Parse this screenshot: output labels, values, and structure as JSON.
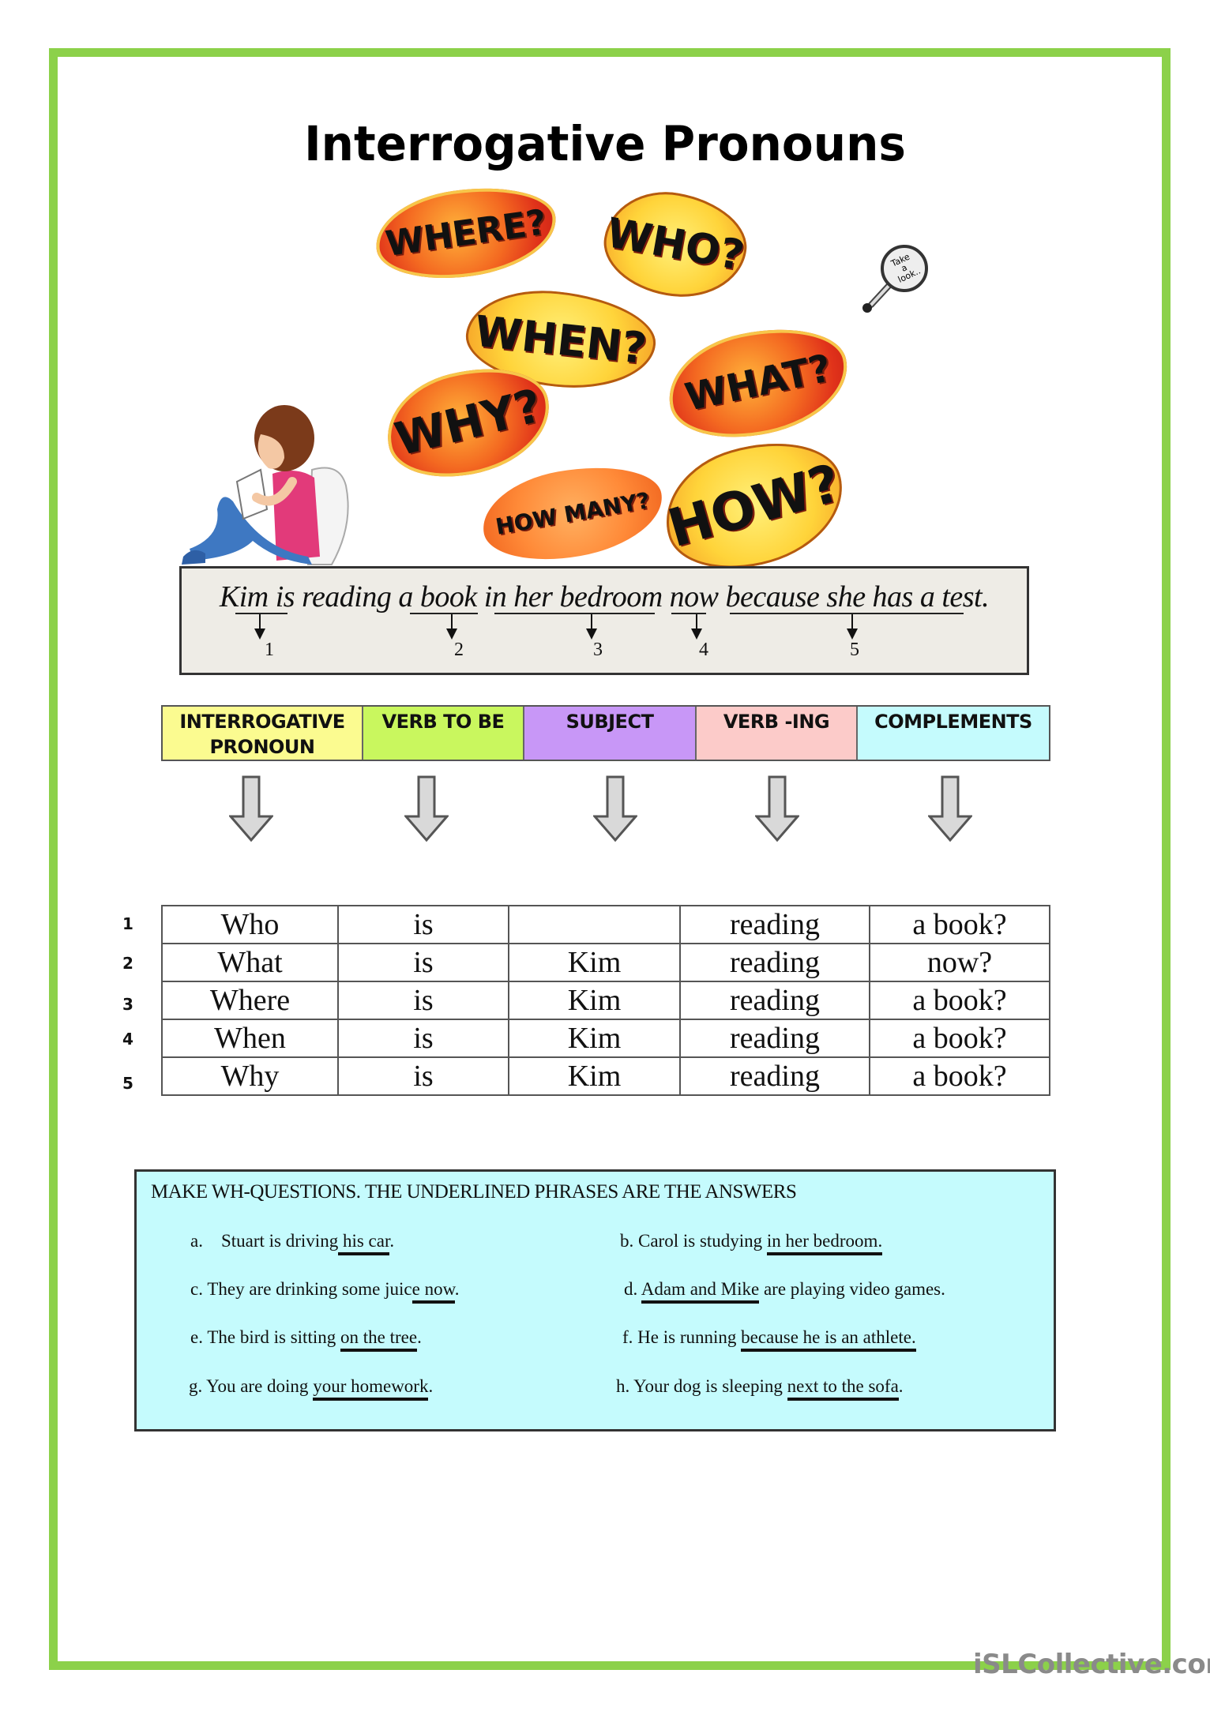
{
  "page": {
    "title": "Interrogative Pronouns",
    "border_color": "#8cd14a",
    "watermark": "iSLCollective.com"
  },
  "illustration": {
    "bubbles": [
      {
        "text": "WHERE?",
        "style": "red"
      },
      {
        "text": "WHO?",
        "style": "yellow"
      },
      {
        "text": "WHEN?",
        "style": "yellow"
      },
      {
        "text": "WHAT?",
        "style": "red"
      },
      {
        "text": "WHY?",
        "style": "red"
      },
      {
        "text": "HOW MANY?",
        "style": "orange"
      },
      {
        "text": "HOW?",
        "style": "yellow"
      }
    ],
    "magnifier_text": "Take a look..",
    "girl_alt": "girl reading a book"
  },
  "sentence_box": {
    "parts": [
      {
        "text": "Kim",
        "underlined": true,
        "number": "1"
      },
      {
        "text": " is reading ",
        "underlined": false
      },
      {
        "text": "a book",
        "underlined": true,
        "number": "2"
      },
      {
        "text": " ",
        "underlined": false
      },
      {
        "text": "in her bedroom",
        "underlined": true,
        "number": "3"
      },
      {
        "text": " ",
        "underlined": false
      },
      {
        "text": "now",
        "underlined": true,
        "number": "4"
      },
      {
        "text": " ",
        "underlined": false
      },
      {
        "text": "because she has a test.",
        "underlined": true,
        "number": "5"
      }
    ],
    "numbers": [
      "1",
      "2",
      "3",
      "4",
      "5"
    ]
  },
  "structure_header": [
    {
      "label_line1": "INTERROGATIVE",
      "label_line2": "PRONOUN",
      "color": "#fbfb90"
    },
    {
      "label_line1": "VERB TO BE",
      "label_line2": "",
      "color": "#c9f75e"
    },
    {
      "label_line1": "SUBJECT",
      "label_line2": "",
      "color": "#c897f7"
    },
    {
      "label_line1": "VERB -ING",
      "label_line2": "",
      "color": "#fccbc9"
    },
    {
      "label_line1": "COMPLEMENTS",
      "label_line2": "",
      "color": "#c5fbfd"
    }
  ],
  "questions_table": {
    "rows": [
      {
        "num": "1",
        "cells": [
          "Who",
          "is",
          "",
          "reading",
          "a book?"
        ]
      },
      {
        "num": "2",
        "cells": [
          "What",
          "is",
          "Kim",
          "reading",
          "now?"
        ]
      },
      {
        "num": "3",
        "cells": [
          "Where",
          "is",
          "Kim",
          "reading",
          "a book?"
        ]
      },
      {
        "num": "4",
        "cells": [
          "When",
          "is",
          "Kim",
          "reading",
          "a book?"
        ]
      },
      {
        "num": "5",
        "cells": [
          "Why",
          "is",
          "Kim",
          "reading",
          "a book?"
        ]
      }
    ]
  },
  "exercise": {
    "title": "MAKE WH-QUESTIONS. THE UNDERLINED PHRASES ARE THE ANSWERS",
    "background": "#c5fbfd",
    "items": [
      {
        "label": "a.",
        "before": "Stuart is driving",
        "underlined": " his car",
        "after": "."
      },
      {
        "label": "b.",
        "before": "Carol is studying ",
        "underlined": "in her bedroom.",
        "after": ""
      },
      {
        "label": "c.",
        "before": "They are drinking some juic",
        "underlined": "e now",
        "after": "."
      },
      {
        "label": "d.",
        "before": "",
        "underlined": "Adam and Mike",
        "after": " are playing video games."
      },
      {
        "label": "e.",
        "before": "The bird is sitting ",
        "underlined": "on the tree",
        "after": "."
      },
      {
        "label": "f.",
        "before": "He is running ",
        "underlined": "because he is an athlete.",
        "after": ""
      },
      {
        "label": "g.",
        "before": "You are doing ",
        "underlined": "your homework",
        "after": "."
      },
      {
        "label": "h.",
        "before": "Your dog is sleeping ",
        "underlined": "next to the sofa",
        "after": "."
      }
    ]
  }
}
